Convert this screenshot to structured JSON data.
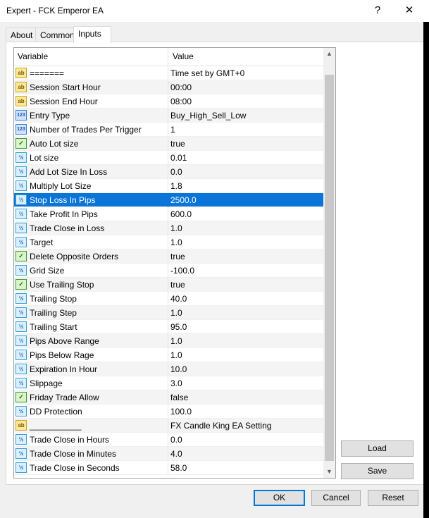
{
  "window": {
    "title": "Expert - FCK Emperor EA",
    "help_glyph": "?",
    "close_glyph": "✕"
  },
  "tabs": [
    {
      "label": "About"
    },
    {
      "label": "Common"
    },
    {
      "label": "Inputs"
    }
  ],
  "grid": {
    "headers": {
      "variable": "Variable",
      "value": "Value"
    },
    "rows": [
      {
        "icon": "ab",
        "variable": "=======",
        "value": "Time set by GMT+0"
      },
      {
        "icon": "ab",
        "variable": "Session Start Hour",
        "value": "00:00"
      },
      {
        "icon": "ab",
        "variable": "Session End Hour",
        "value": "08:00"
      },
      {
        "icon": "123",
        "variable": "Entry Type",
        "value": "Buy_High_Sell_Low"
      },
      {
        "icon": "123",
        "variable": "Number of Trades Per Trigger",
        "value": "1"
      },
      {
        "icon": "bool",
        "variable": "Auto Lot size",
        "value": "true"
      },
      {
        "icon": "half",
        "variable": "Lot size",
        "value": "0.01"
      },
      {
        "icon": "half",
        "variable": "Add Lot Size In Loss",
        "value": "0.0"
      },
      {
        "icon": "half",
        "variable": "Multiply Lot Size",
        "value": "1.8"
      },
      {
        "icon": "half",
        "variable": "Stop Loss In Pips",
        "value": "2500.0",
        "selected": true
      },
      {
        "icon": "half",
        "variable": "Take Profit In Pips",
        "value": "600.0"
      },
      {
        "icon": "half",
        "variable": "Trade Close in Loss",
        "value": "1.0"
      },
      {
        "icon": "half",
        "variable": "Target",
        "value": "1.0"
      },
      {
        "icon": "bool",
        "variable": "Delete Opposite Orders",
        "value": "true"
      },
      {
        "icon": "half",
        "variable": "Grid Size",
        "value": "-100.0"
      },
      {
        "icon": "bool",
        "variable": "Use Trailing Stop",
        "value": "true"
      },
      {
        "icon": "half",
        "variable": "Trailing Stop",
        "value": "40.0"
      },
      {
        "icon": "half",
        "variable": "Trailing Step",
        "value": "1.0"
      },
      {
        "icon": "half",
        "variable": "Trailing Start",
        "value": "95.0"
      },
      {
        "icon": "half",
        "variable": "Pips Above Range",
        "value": "1.0"
      },
      {
        "icon": "half",
        "variable": "Pips Below Rage",
        "value": "1.0"
      },
      {
        "icon": "half",
        "variable": "Expiration In Hour",
        "value": "10.0"
      },
      {
        "icon": "half",
        "variable": "Slippage",
        "value": "3.0"
      },
      {
        "icon": "bool",
        "variable": "Friday Trade Allow",
        "value": "false"
      },
      {
        "icon": "half",
        "variable": "DD Protection",
        "value": "100.0"
      },
      {
        "icon": "ab",
        "variable": "___________",
        "value": "FX Candle King EA Setting"
      },
      {
        "icon": "half",
        "variable": "Trade Close in Hours",
        "value": "0.0"
      },
      {
        "icon": "half",
        "variable": "Trade Close in Minutes",
        "value": "4.0"
      },
      {
        "icon": "half",
        "variable": "Trade Close in Seconds",
        "value": "58.0"
      }
    ],
    "icon_glyphs": {
      "ab": "ab",
      "123": "123",
      "half": "½",
      "bool": "✓"
    }
  },
  "side_buttons": {
    "load": "Load",
    "save": "Save"
  },
  "footer_buttons": {
    "ok": "OK",
    "cancel": "Cancel",
    "reset": "Reset"
  },
  "scrollbar": {
    "up": "▲",
    "down": "▼"
  }
}
